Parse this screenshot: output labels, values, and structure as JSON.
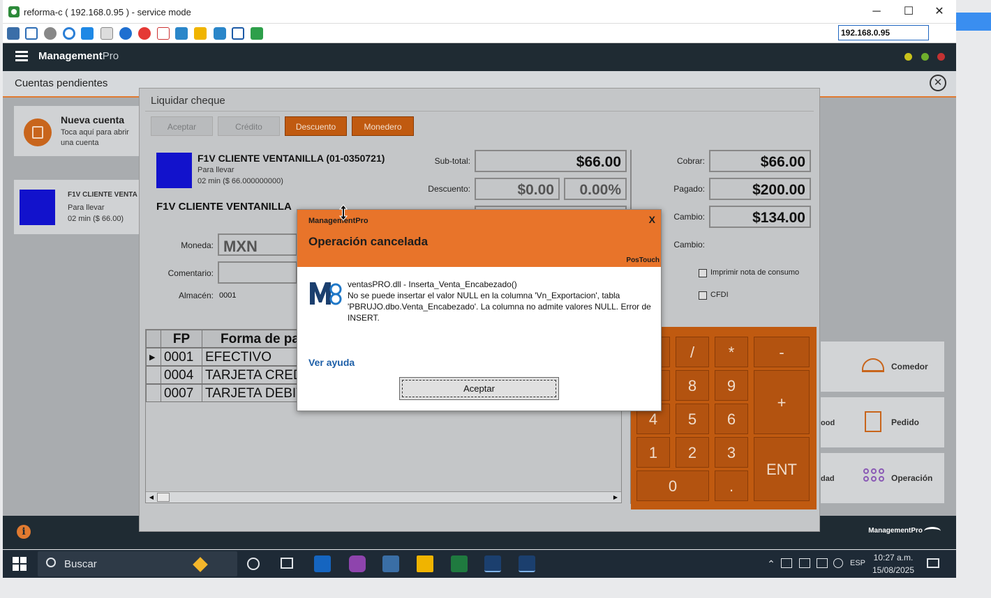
{
  "window": {
    "title": "reforma-c ( 192.168.0.95 ) - service mode",
    "minimize": "─",
    "maximize": "☐",
    "close": "✕",
    "ip_value": "192.168.0.95"
  },
  "app": {
    "brand_main": "Management",
    "brand_suffix": "Pro",
    "footer_brand": "ManagementPro"
  },
  "pendientes": {
    "title": "Cuentas pendientes",
    "close_symbol": "✕",
    "new_account_title": "Nueva cuenta",
    "new_account_sub": "Toca aquí para abrir una cuenta",
    "account_name": "F1V CLIENTE VENTA",
    "account_type": "Para llevar",
    "account_info": "02 min ($ 66.00)"
  },
  "liquidar": {
    "title": "Liquidar cheque",
    "buttons": {
      "aceptar": "Aceptar",
      "credito": "Crédito",
      "descuento": "Descuento",
      "monedero": "Monedero"
    },
    "client_title": "F1V CLIENTE VENTANILLA (01-0350721)",
    "client_type": "Para llevar",
    "client_info": "02 min ($ 66.000000000)",
    "client_name": "F1V CLIENTE VENTANILLA",
    "labels": {
      "subtotal": "Sub-total:",
      "descuento": "Descuento:",
      "moneda": "Moneda:",
      "comentario": "Comentario:",
      "almacen": "Almacén:",
      "cobrar": "Cobrar:",
      "pagado": "Pagado:",
      "cambio1": "Cambio:",
      "cambio2": "Cambio:",
      "imprimir": "Imprimir nota de consumo",
      "cfdi": "CFDI"
    },
    "values": {
      "subtotal": "$66.00",
      "descuento": "$0.00",
      "descuento_pct": "0.00%",
      "moneda": "MXN",
      "almacen": "0001",
      "cobrar": "$66.00",
      "pagado": "$200.00",
      "cambio": "$134.00"
    },
    "grid": {
      "headers": [
        "FP",
        "Forma de pa"
      ],
      "rows": [
        {
          "fp": "0001",
          "forma": "EFECTIVO"
        },
        {
          "fp": "0004",
          "forma": "TARJETA CREDITO"
        },
        {
          "fp": "0007",
          "forma": "TARJETA DEBITO"
        }
      ],
      "row_arrow": "▶",
      "scroll_left": "◀",
      "scroll_right": "▶"
    },
    "keypad": {
      "k_slash": "/",
      "k_star": "*",
      "k_minus": "-",
      "k8": "8",
      "k9": "9",
      "k_plus": "+",
      "k4": "4",
      "k5": "5",
      "k6": "6",
      "k1": "1",
      "k2": "2",
      "k3": "3",
      "k_ent": "ENT",
      "k0": "0",
      "k_dot": "."
    }
  },
  "tiles": {
    "comedor": "Comedor",
    "pedido": "Pedido",
    "operacion": "Operación",
    "food_partial": "ood",
    "dad_partial": "dad"
  },
  "modal": {
    "app_name": "ManagementPro",
    "close": "X",
    "title": "Operación cancelada",
    "product": "PosTouch",
    "message_line1": "ventasPRO.dll - Inserta_Venta_Encabezado()",
    "message_line2": "No se puede insertar el valor NULL en la columna 'Vn_Exportacion', tabla 'PBRUJO.dbo.Venta_Encabezado'. La columna no admite valores NULL. Error de INSERT.",
    "help_link": "Ver ayuda",
    "ok_button": "Aceptar"
  },
  "taskbar": {
    "search_text": "Buscar",
    "language": "ESP",
    "time": "10:27 a.m.",
    "date": "15/08/2025"
  },
  "colors": {
    "accent_orange": "#e8742a",
    "header_dark": "#1f2b33",
    "link_blue": "#1d5fa8"
  }
}
